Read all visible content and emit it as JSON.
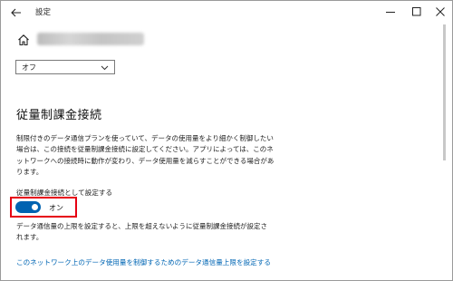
{
  "window": {
    "title": "設定"
  },
  "network": {
    "select_value": "オフ"
  },
  "metered": {
    "heading": "従量制課金接続",
    "description": "制限付きのデータ通信プランを使っていて、データの使用量をより細かく制御したい場合は、この接続を従量制課金接続に設定してください。アプリによっては、このネットワークへの接続時に動作が変わり、データ使用量を減らすことができる場合があります。",
    "toggle_label": "従量制課金接続として設定する",
    "toggle_state": "オン",
    "toggle_on": true,
    "note": "データ通信量の上限を設定すると、上限を超えないように従量制課金接続が設定されます。",
    "link": "このネットワーク上のデータ使用量を制御するためのデータ通信量上限を設定する"
  },
  "colors": {
    "accent": "#0063b1",
    "highlight": "#e60012",
    "link": "#0066b4"
  },
  "icons": {
    "back": "back-arrow-icon",
    "home": "home-icon",
    "minimize": "minimize-icon",
    "maximize": "maximize-icon",
    "close": "close-icon",
    "chevron": "chevron-down-icon"
  }
}
